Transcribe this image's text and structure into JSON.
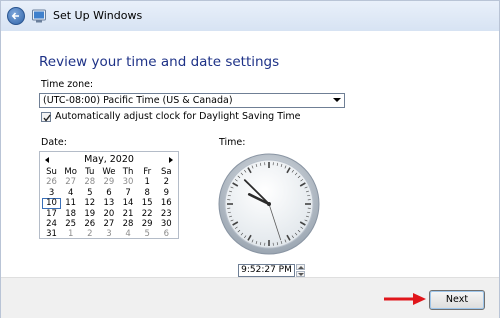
{
  "window": {
    "title": "Set Up Windows"
  },
  "page": {
    "heading": "Review your time and date settings",
    "timezone_label": "Time zone:",
    "timezone_value": "(UTC-08:00) Pacific Time (US & Canada)",
    "dst_label": "Automatically adjust clock for Daylight Saving Time",
    "dst_checked": true,
    "date_label": "Date:",
    "time_label": "Time:"
  },
  "calendar": {
    "month": "May, 2020",
    "weekdays": [
      "Su",
      "Mo",
      "Tu",
      "We",
      "Th",
      "Fr",
      "Sa"
    ],
    "weeks": [
      [
        "26",
        "27",
        "28",
        "29",
        "30",
        "1",
        "2"
      ],
      [
        "3",
        "4",
        "5",
        "6",
        "7",
        "8",
        "9"
      ],
      [
        "10",
        "11",
        "12",
        "13",
        "14",
        "15",
        "16"
      ],
      [
        "17",
        "18",
        "19",
        "20",
        "21",
        "22",
        "23"
      ],
      [
        "24",
        "25",
        "26",
        "27",
        "28",
        "29",
        "30"
      ],
      [
        "31",
        "1",
        "2",
        "3",
        "4",
        "5",
        "6"
      ]
    ],
    "selected": "10"
  },
  "clock": {
    "time_value": "9:52:27 PM"
  },
  "footer": {
    "next_label": "Next"
  },
  "colors": {
    "heading": "#1e3287",
    "annotation_arrow": "#e0161b"
  }
}
